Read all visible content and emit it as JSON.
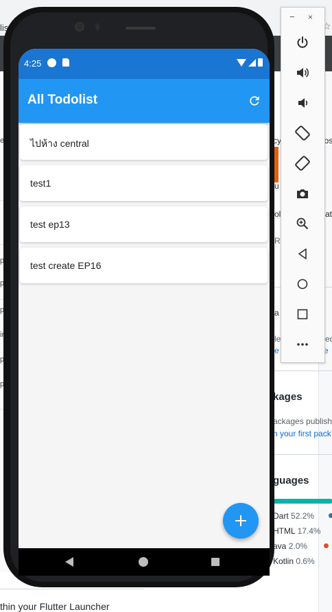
{
  "background": {
    "tab_fragment": "lis",
    "left_chars": [
      "e",
      "p",
      "p",
      "p",
      "ir",
      "p",
      "p"
    ],
    "right": {
      "frag_cy": "cy",
      "frag_posi": "posi",
      "frag_u": "u",
      "frag_ol": "ol",
      "frag_at": "at",
      "frag_r": "R",
      "frag_a": "a",
      "frag_le": "le",
      "frag_ed": "ed",
      "frag_e_link": "e",
      "frag_e2_link": "e",
      "packages_heading": "kages",
      "packages_text": "ackages publishe",
      "packages_link": "h your first pack",
      "languages_heading": "guages"
    },
    "languages": [
      {
        "name": "Dart",
        "percent": "52.2%",
        "color": "#00b4ab"
      },
      {
        "name": "HTML",
        "percent": "17.4%",
        "color": "#e34c26"
      },
      {
        "name": "ava",
        "percent": "2.0%",
        "color": "#b07219"
      },
      {
        "name": "Kotlin",
        "percent": "0.6%",
        "color": "#a97bff"
      }
    ],
    "bottom_text": "thin your Flutter Launcher"
  },
  "status_bar": {
    "time": "4:25"
  },
  "app": {
    "title": "All Todolist",
    "todos": [
      "ไปห้าง central",
      "test1",
      "test ep13",
      "test create EP16"
    ]
  },
  "colors": {
    "primary": "#2196f3",
    "status_bar": "#1976d2"
  },
  "emulator_toolbar": {
    "minimize": "−",
    "close": "×",
    "buttons": [
      "power-icon",
      "volume-up-icon",
      "volume-down-icon",
      "rotate-left-icon",
      "rotate-right-icon",
      "camera-icon",
      "zoom-icon",
      "back-icon",
      "home-icon",
      "overview-icon",
      "more-icon"
    ]
  }
}
